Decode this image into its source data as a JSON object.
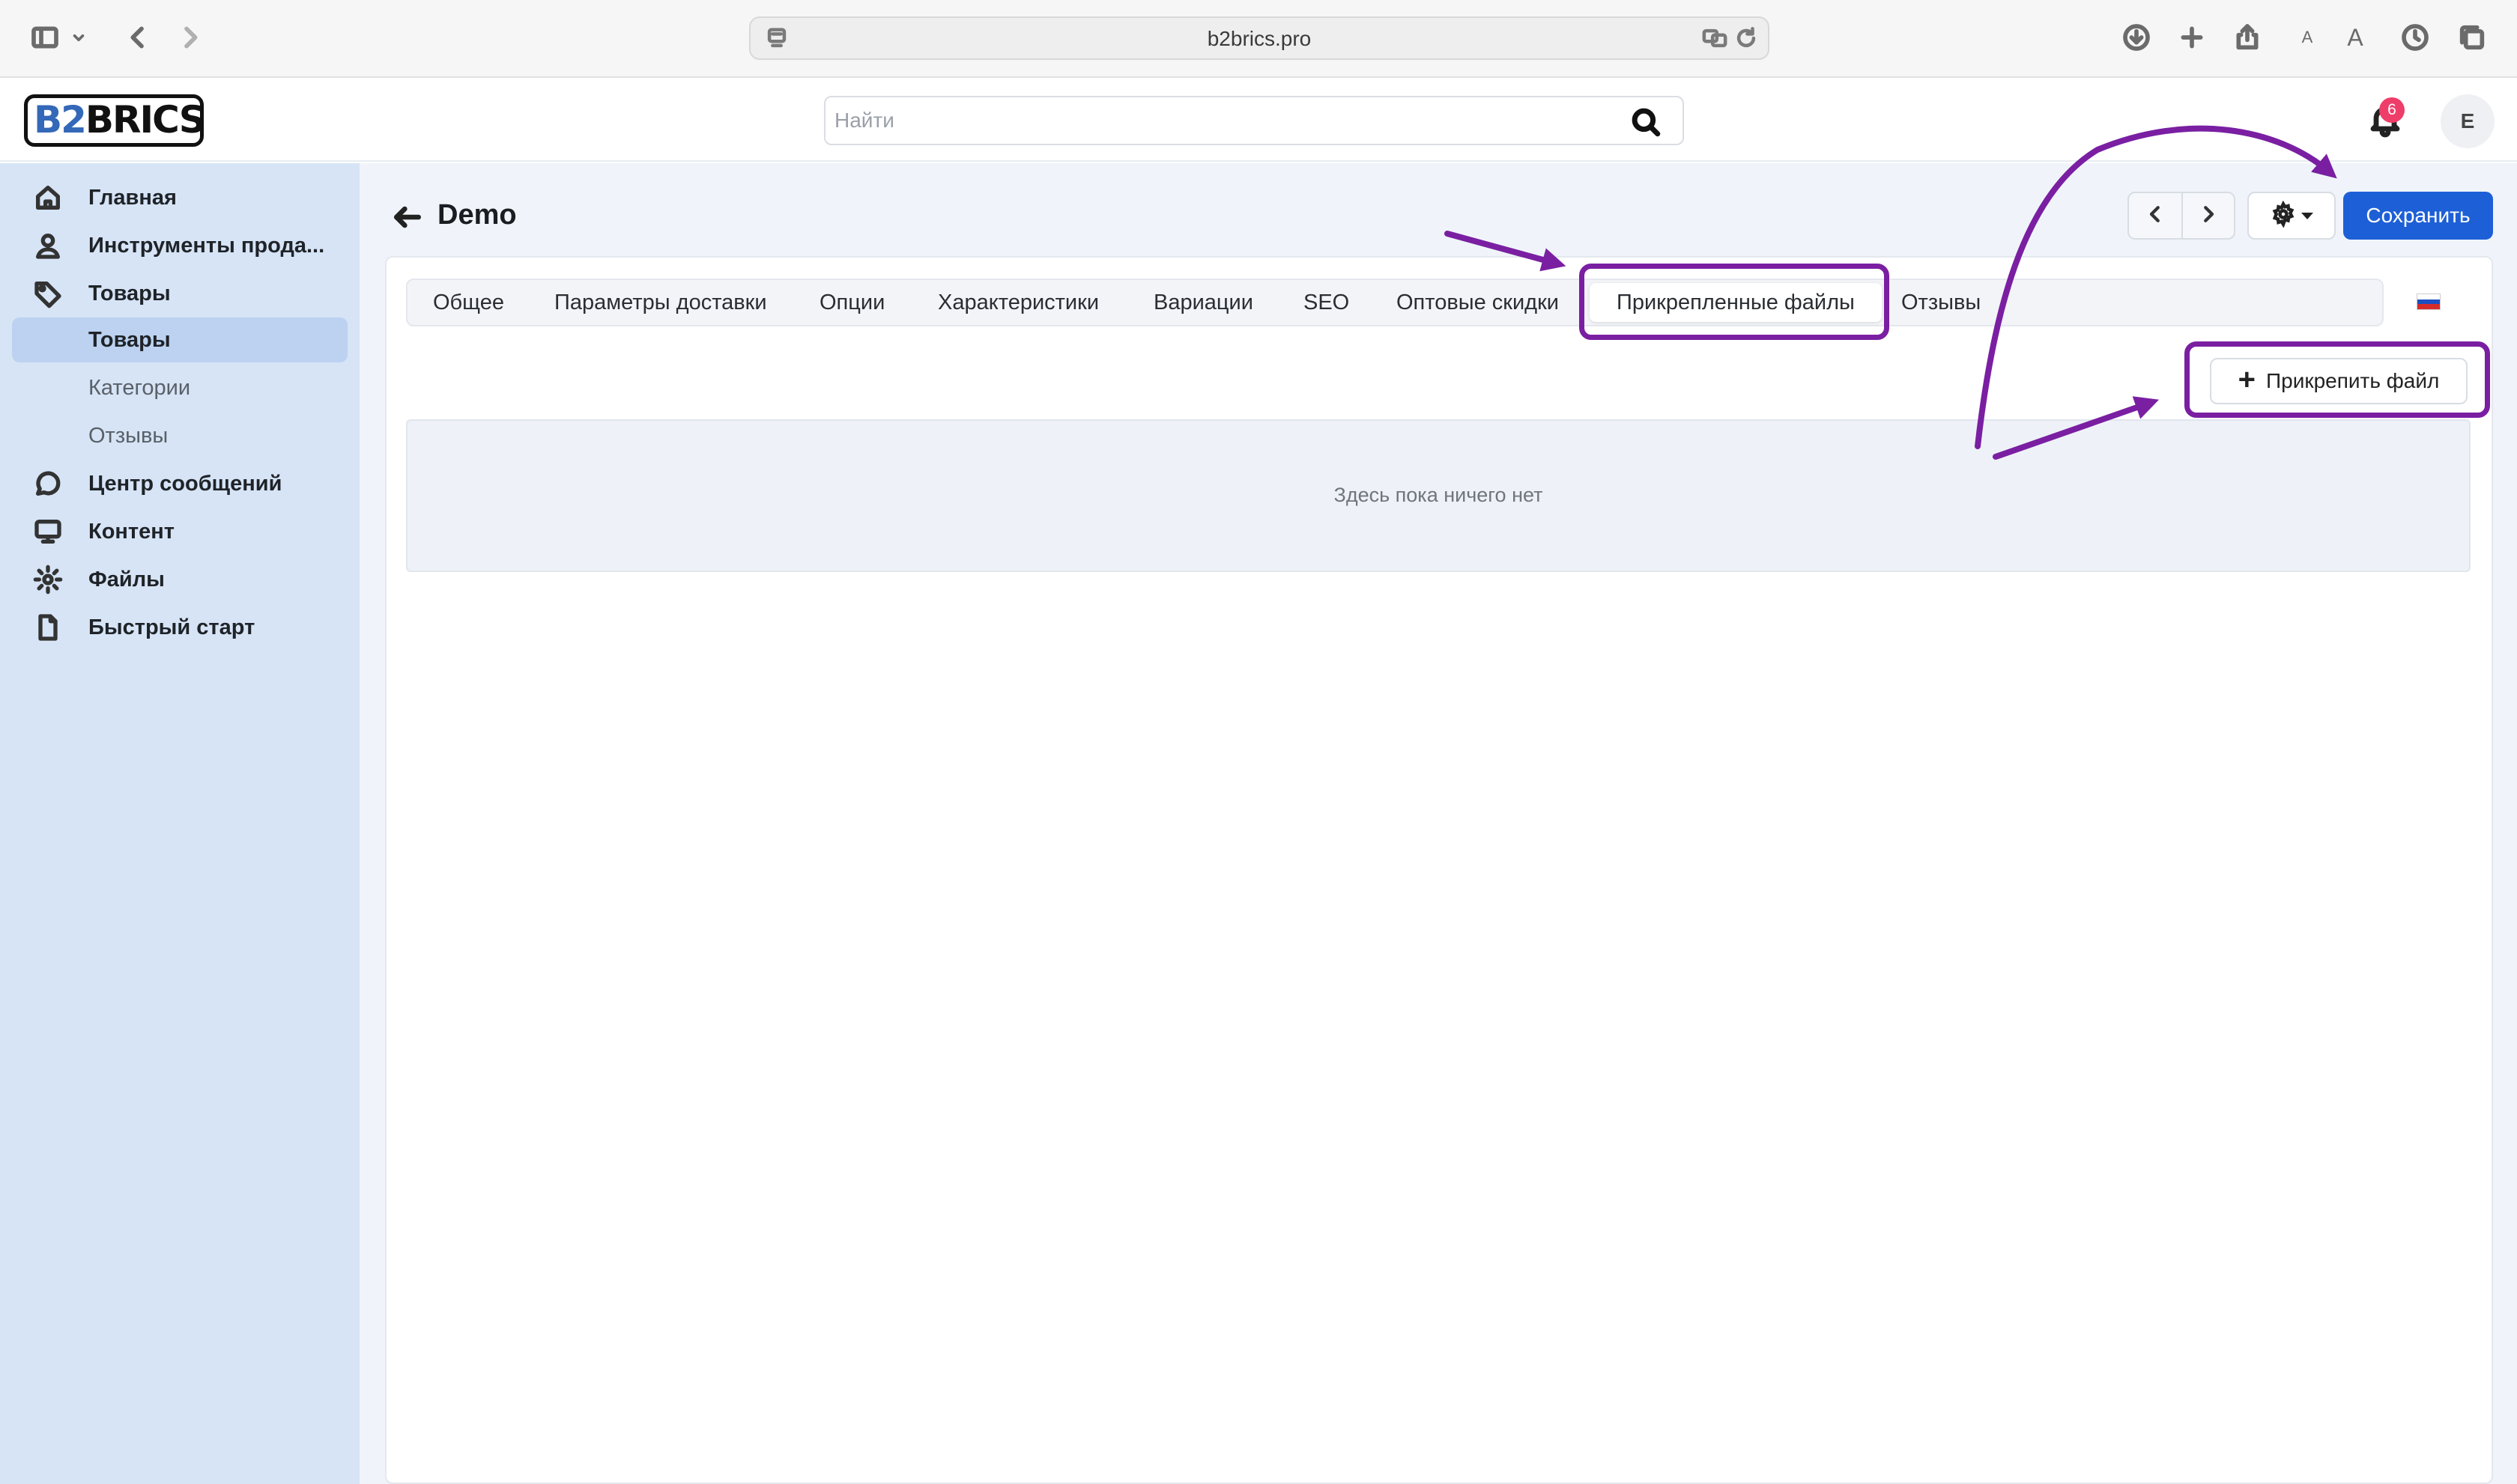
{
  "browser": {
    "url": "b2brics.pro",
    "icons": [
      "sidebar-toggle-icon",
      "chevron-down-icon",
      "back-icon",
      "forward-icon",
      "page-icon",
      "translate-icon",
      "reload-icon",
      "download-icon",
      "new-tab-icon",
      "share-icon",
      "text-smaller-icon",
      "text-larger-icon",
      "history-icon",
      "tabs-overview-icon"
    ],
    "text_small": "A",
    "text_large": "A"
  },
  "header": {
    "logo_b2": "B2",
    "logo_brics": "BRICS",
    "search_placeholder": "Найти",
    "notifications_count": "6",
    "avatar_initial": "E"
  },
  "sidebar": {
    "items": [
      {
        "label": "Главная",
        "icon": "home-icon"
      },
      {
        "label": "Инструменты прода...",
        "icon": "user-icon"
      },
      {
        "label": "Товары",
        "icon": "tag-icon"
      },
      {
        "label": "Товары",
        "active": true
      },
      {
        "label": "Категории"
      },
      {
        "label": "Отзывы"
      },
      {
        "label": "Центр сообщений",
        "icon": "chat-icon"
      },
      {
        "label": "Контент",
        "icon": "monitor-icon"
      },
      {
        "label": "Файлы",
        "icon": "gear-icon"
      },
      {
        "label": "Быстрый старт",
        "icon": "document-icon"
      }
    ]
  },
  "page": {
    "title": "Demo",
    "save_label": "Сохранить",
    "tabs": [
      "Общее",
      "Параметры доставки",
      "Опции",
      "Характеристики",
      "Вариации",
      "SEO",
      "Оптовые скидки",
      "Прикрепленные файлы",
      "Отзывы"
    ],
    "active_tab": "Прикрепленные файлы",
    "attach_label": "Прикрепить файл",
    "empty_text": "Здесь пока ничего нет"
  },
  "colors": {
    "accent": "#1d5fd6",
    "sidebar_bg": "#d6e4f6",
    "annotation": "#7a1fa2",
    "badge": "#ef3d6a"
  }
}
